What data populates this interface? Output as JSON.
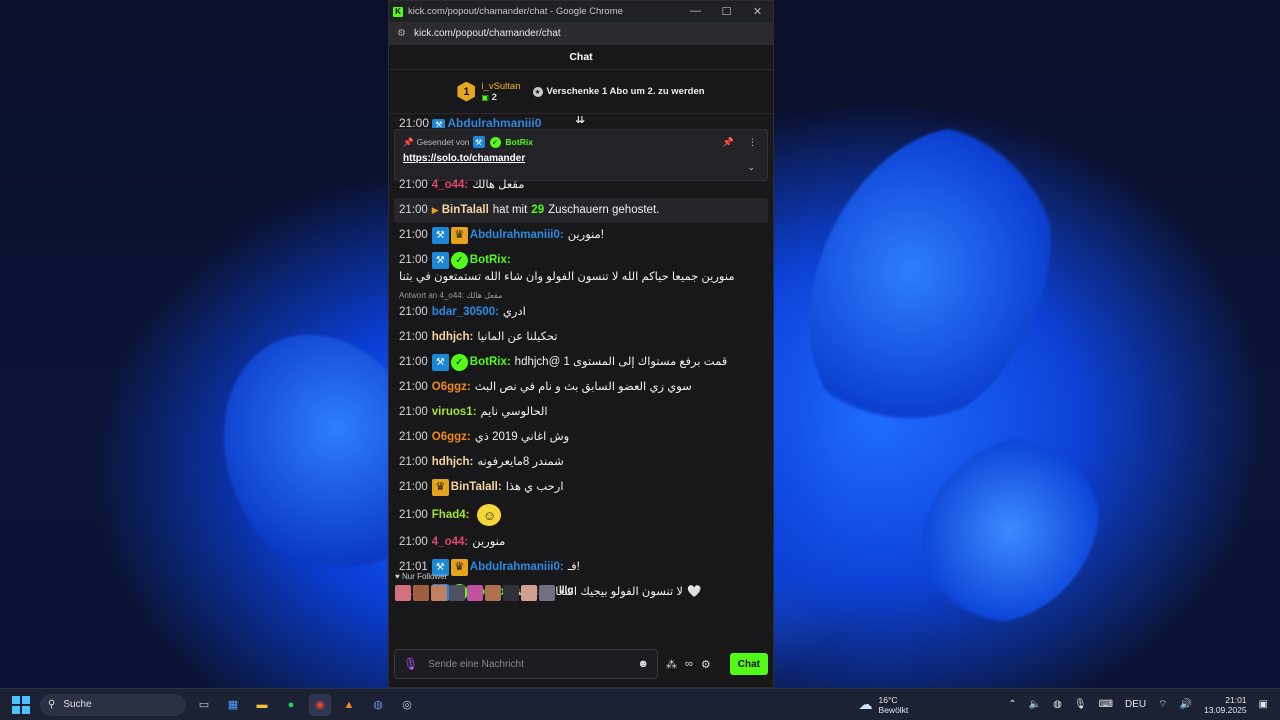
{
  "window": {
    "title": "kick.com/popout/chamander/chat - Google Chrome",
    "url": "kick.com/popout/chamander/chat",
    "controls": [
      "—",
      "☐",
      "✕"
    ]
  },
  "chat": {
    "header": "Chat",
    "gift": {
      "rank": "1",
      "user": "i_vSultan",
      "count": "2",
      "cta": "Verschenke 1 Abo um 2. zu werden"
    },
    "peek_user": "Abdulrahmaniii0",
    "pinned": {
      "sent_by_label": "Gesendet von",
      "bot": "BotRix",
      "link": "https://solo.to/chamander"
    },
    "messages": [
      {
        "time": "21:00",
        "user": "4_o44:",
        "text": "مقعل هالك",
        "color": "#e0476c"
      },
      {
        "type": "host",
        "time": "21:00",
        "user": "BinTalall",
        "pre": "hat mit",
        "num": "29",
        "post": "Zuschauern gehostet."
      },
      {
        "time": "21:00",
        "user": "Abdulrahmaniii0:",
        "text": "!منورين",
        "color": "#2f8ae0",
        "badges": [
          "mod",
          "crown"
        ]
      },
      {
        "time": "21:00",
        "user": "BotRix:",
        "text": "منورين جميعا حياكم الله لا تنسون الفولو وان شاء الله تستمتعون في بثنا",
        "color": "#53fc18",
        "badges": [
          "mod",
          "verif"
        ]
      },
      {
        "reply": "Antwort an 4_o44: مقعل هالك",
        "time": "21:00",
        "user": "bdar_30500:",
        "text": "ادري",
        "color": "#2f8ae0"
      },
      {
        "time": "21:00",
        "user": "hdhjch:",
        "text": "تحكيلنا عن المانيا",
        "color": "#f5d5a0"
      },
      {
        "time": "21:00",
        "user": "BotRix:",
        "text": "قمت برفع مستواك إلى المستوى 1 @hdhjch",
        "color": "#53fc18",
        "badges": [
          "mod",
          "verif"
        ]
      },
      {
        "time": "21:00",
        "user": "O6ggz:",
        "text": "سوي زي العضو السابق بث و نام في نص البث",
        "color": "#f08a1c"
      },
      {
        "time": "21:00",
        "user": "viruos1:",
        "text": "الحالوسي نايم",
        "color": "#a6e22e"
      },
      {
        "time": "21:00",
        "user": "O6ggz:",
        "text": "وش اغاني 2019 ذي",
        "color": "#f08a1c"
      },
      {
        "time": "21:00",
        "user": "hdhjch:",
        "text": "شمندر 8مايعرفونه",
        "color": "#f5d5a0"
      },
      {
        "time": "21:00",
        "user": "BinTalall:",
        "text": "ارحب ي هذا",
        "color": "#f5d5a0",
        "badges": [
          "crown"
        ]
      },
      {
        "time": "21:00",
        "user": "Fhad4:",
        "text": "",
        "color": "#a6e22e",
        "emote": "smile-emote"
      },
      {
        "time": "21:00",
        "user": "4_o44:",
        "text": "منورين",
        "color": "#e0476c"
      },
      {
        "time": "21:01",
        "user": "Abdulrahmaniii0:",
        "text": "!فـ",
        "color": "#2f8ae0",
        "badges": [
          "mod",
          "crown"
        ]
      },
      {
        "time": "21:01",
        "user": "BotRix:",
        "text": "لا تنسون الفولو بيجيك اشعار اذا بثينا",
        "color": "#53fc18",
        "badges": [
          "mod",
          "verif"
        ],
        "heart": "🤍"
      }
    ],
    "follower_mode": "Nur Follower",
    "avatar_more": "lllg",
    "input_placeholder": "Sende eine Nachricht",
    "send_label": "Chat",
    "tools": [
      "∞"
    ]
  },
  "taskbar": {
    "search": "Suche",
    "weather_temp": "16°C",
    "weather_desc": "Bewölkt",
    "lang": "DEU",
    "time": "21:01",
    "date": "13.09.2025"
  },
  "colors": {
    "kick_green": "#53fc18",
    "chat_bg": "#18181b"
  }
}
